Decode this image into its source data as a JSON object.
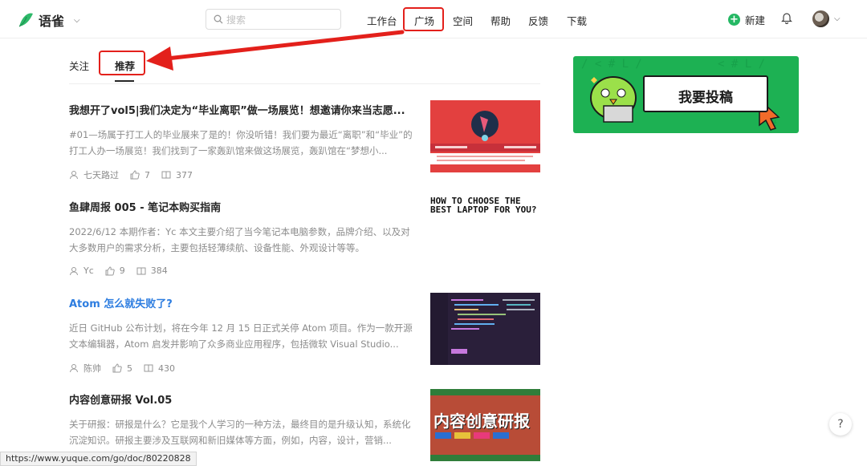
{
  "header": {
    "logo_text": "语雀",
    "search_placeholder": "搜索",
    "nav": [
      {
        "label": "工作台"
      },
      {
        "label": "广场"
      },
      {
        "label": "空间"
      },
      {
        "label": "帮助"
      },
      {
        "label": "反馈"
      },
      {
        "label": "下载"
      }
    ],
    "new_label": "新建",
    "plus_glyph": "+"
  },
  "tabs": {
    "follow": "关注",
    "recommend": "推荐"
  },
  "articles": [
    {
      "title": "我想开了vol5|我们决定为“毕业离职”做一场展览！想邀请你来当志愿...",
      "desc": "#01—场属于打工人的毕业展来了是的！你没听错！我们要为最近“离职”和“毕业”的打工人办一场展览！我们找到了一家轰趴馆来做这场展览，轰趴馆在“梦想小...",
      "author": "七天路过",
      "likes": "7",
      "reads": "377"
    },
    {
      "title": "鱼肆周报 005 - 笔记本购买指南",
      "desc": "2022/6/12 本期作者：Yc 本文主要介绍了当今笔记本电脑参数，品牌介绍、以及对大多数用户的需求分析，主要包括轻薄续航、设备性能、外观设计等等。",
      "author": "Yc",
      "likes": "9",
      "reads": "384",
      "thumb_text": "HOW TO CHOOSE THE BEST LAPTOP FOR YOU?"
    },
    {
      "title": "Atom 怎么就失败了?",
      "desc": "近日 GitHub 公布计划，将在今年 12 月 15 日正式关停 Atom 项目。作为一款开源文本编辑器，Atom 启发并影响了众多商业应用程序，包括微软 Visual Studio...",
      "author": "陈帅",
      "likes": "5",
      "reads": "430"
    },
    {
      "title": "内容创意研报 Vol.05",
      "desc": "关于研报：研报是什么？它是我个人学习的一种方法，最终目的是升级认知，系统化沉淀知识。研报主要涉及互联网和新旧媒体等方面，例如，内容，设计，营销...",
      "thumb_text": "内容创意研报"
    }
  ],
  "banner": {
    "text": "我要投稿"
  },
  "status_url": "https://www.yuque.com/go/doc/80220828",
  "help": "?"
}
